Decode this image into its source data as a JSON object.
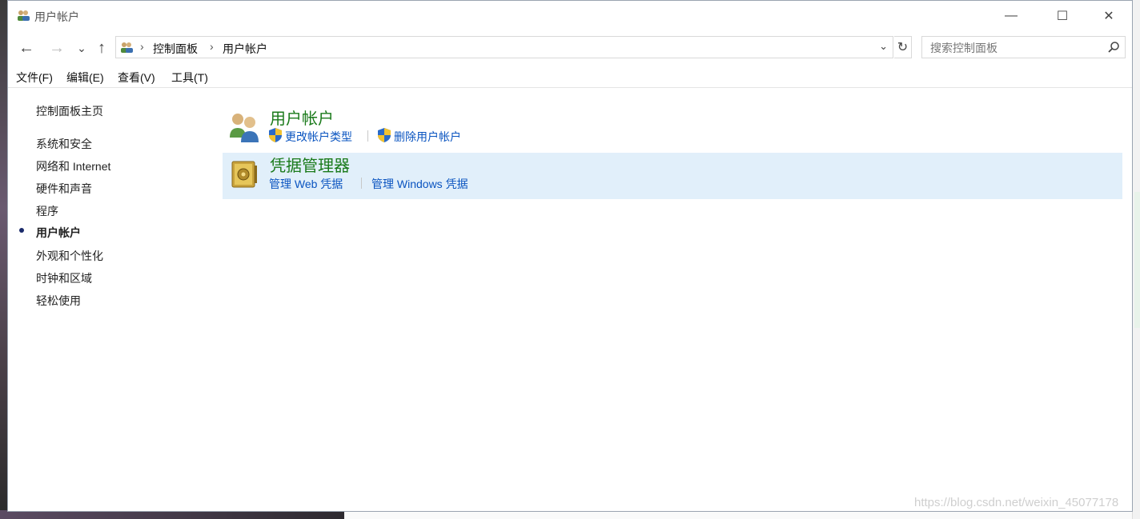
{
  "window": {
    "title": "用户帐户"
  },
  "title_controls": {
    "minimize": "—",
    "maximize": "☐",
    "close": "✕"
  },
  "nav": {
    "back": "←",
    "forward": "→",
    "recent": "⌄",
    "up": "↑",
    "refresh": "↻"
  },
  "address": {
    "crumbs": [
      "控制面板",
      "用户帐户"
    ],
    "separator": "›",
    "dropdown": "⌄"
  },
  "search": {
    "placeholder": "搜索控制面板"
  },
  "menu": [
    "文件(F)",
    "编辑(E)",
    "查看(V)",
    "工具(T)"
  ],
  "sidebar": {
    "home": "控制面板主页",
    "items": [
      "系统和安全",
      "网络和 Internet",
      "硬件和声音",
      "程序",
      "用户帐户",
      "外观和个性化",
      "时钟和区域",
      "轻松使用"
    ],
    "active_index": 4
  },
  "categories": [
    {
      "title": "用户帐户",
      "icon": "users-icon",
      "links": [
        "更改帐户类型",
        "删除用户帐户"
      ],
      "link_icons": [
        "uac-shield-icon",
        "uac-shield-icon"
      ]
    },
    {
      "title": "凭据管理器",
      "icon": "vault-icon",
      "links": [
        "管理 Web 凭据",
        "管理 Windows 凭据"
      ]
    }
  ],
  "watermark": "https://blog.csdn.net/weixin_45077178",
  "colors": {
    "link": "#0a54c0",
    "category_title": "#1a7a1a",
    "highlight": "#e1effa"
  }
}
